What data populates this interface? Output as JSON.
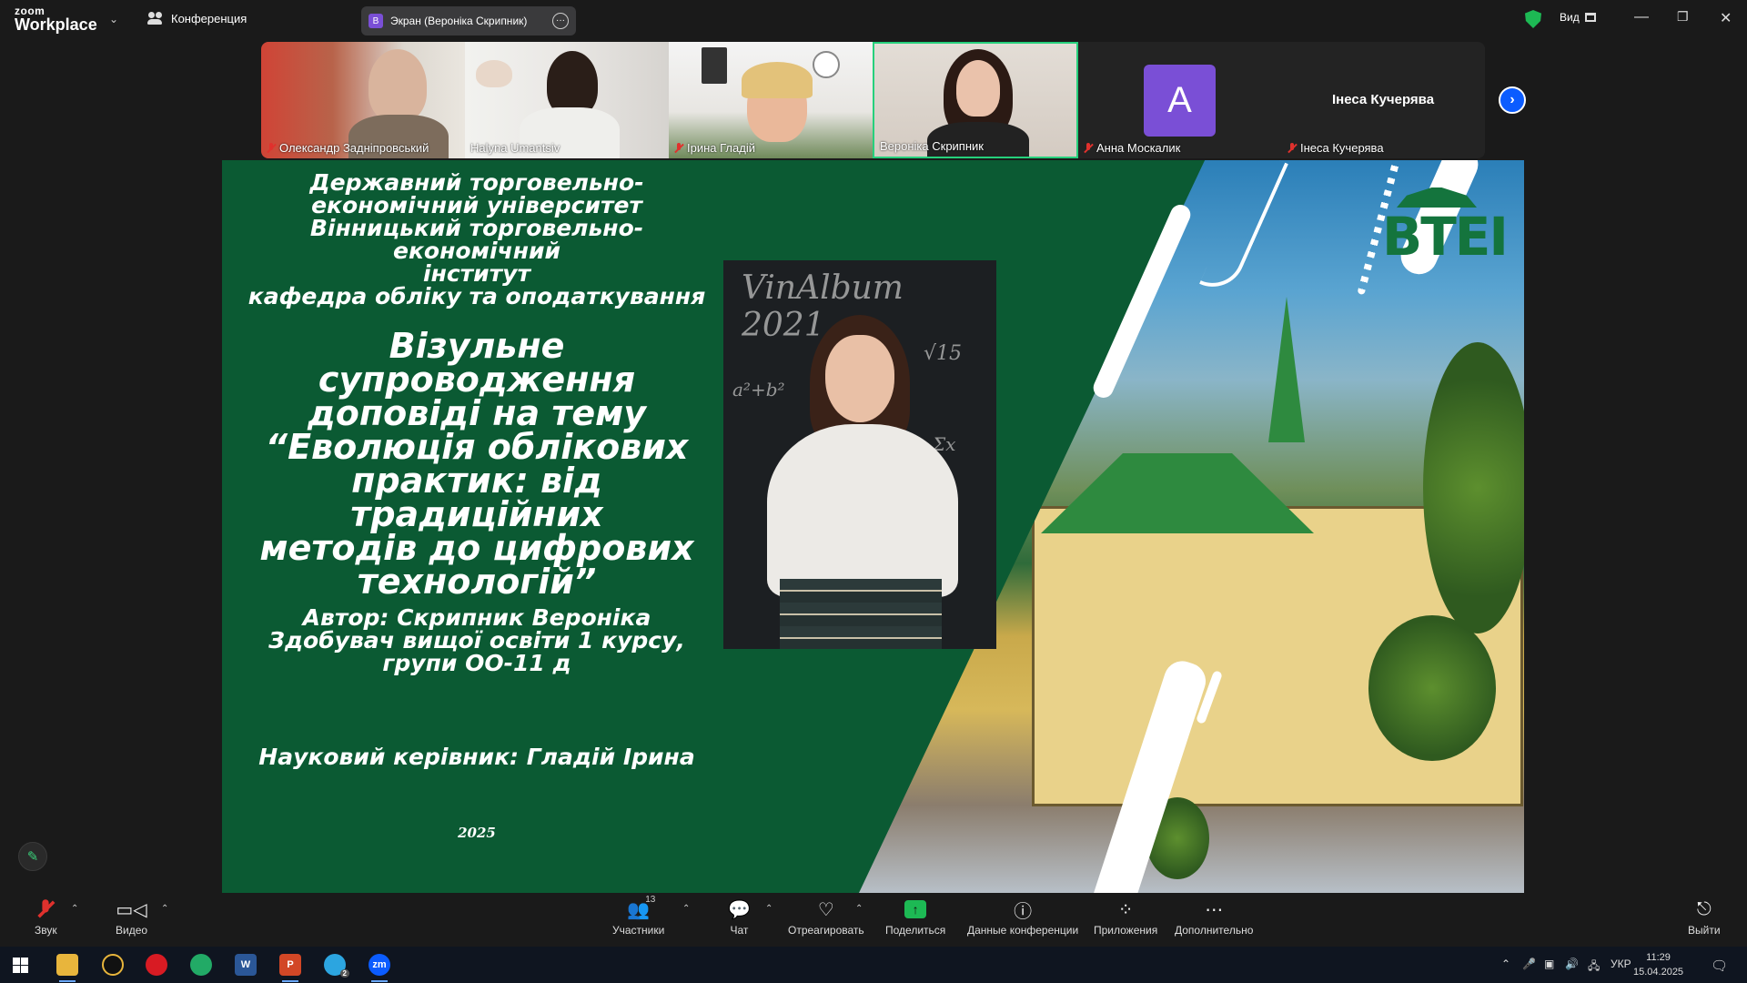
{
  "app": {
    "logo_top": "zoom",
    "logo_bottom": "Workplace"
  },
  "topbar": {
    "conference_label": "Конференция",
    "screen_tab": {
      "badge": "В",
      "label": "Экран (Вероніка Скрипник)"
    },
    "view_label": "Вид"
  },
  "participants": [
    {
      "name": "Олександр Задніпровський",
      "muted": true
    },
    {
      "name": "Halyna Umantsiv",
      "muted": false
    },
    {
      "name": "Ірина Гладій",
      "muted": true
    },
    {
      "name": "Вероніка Скрипник",
      "muted": false,
      "active_speaker": true
    },
    {
      "name": "Анна Москалик",
      "muted": true,
      "avatar_letter": "A"
    },
    {
      "name": "Інеса Кучерява",
      "muted": true,
      "big_label": "Інеса Кучерява"
    }
  ],
  "slide": {
    "institution": [
      "Державний торговельно-",
      "економічний університет",
      "Вінницький торговельно-економічний",
      "інститут",
      "кафедра обліку та оподаткування"
    ],
    "topic": [
      "Візульне супроводження",
      "доповіді на тему",
      "“Еволюція облікових",
      "практик: від традиційних",
      "методів до цифрових",
      "технологій”"
    ],
    "author": [
      "Автор: Скрипник Вероніка",
      "Здобувач вищої освіти 1 курсу,",
      "групи ОО-11 д"
    ],
    "advisor": "Науковий керівник: Гладій Ірина",
    "year": "2025",
    "logo_text": "ВТЕІ",
    "board_text": "VinAlbum 2021"
  },
  "toolbar": {
    "audio": "Звук",
    "video": "Видео",
    "participants": "Участники",
    "participants_count": "13",
    "chat": "Чат",
    "react": "Отреагировать",
    "share": "Поделиться",
    "meeting_info": "Данные конференции",
    "apps": "Приложения",
    "more": "Дополнительно",
    "leave": "Выйти"
  },
  "taskbar": {
    "language": "УКР",
    "time": "11:29",
    "date": "15.04.2025",
    "telegram_badge": "2"
  },
  "colors": {
    "accent_green": "#26d07c",
    "slide_green": "#0b5a33",
    "zoom_blue": "#0b5cff",
    "muted_red": "#e0312d"
  }
}
